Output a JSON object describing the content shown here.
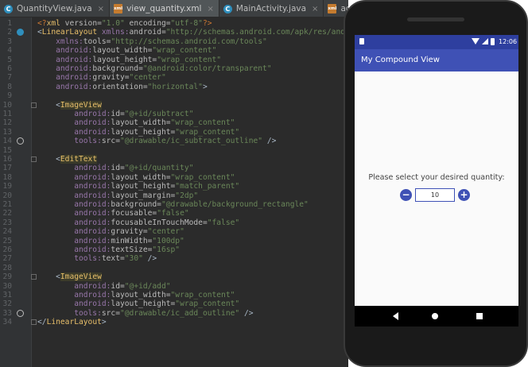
{
  "tabs": [
    {
      "label": "QuantityView.java",
      "icon": "java",
      "icon_char": "C",
      "active": false
    },
    {
      "label": "view_quantity.xml",
      "icon": "xml",
      "icon_char": "xml",
      "active": true
    },
    {
      "label": "MainActivity.java",
      "icon": "java",
      "icon_char": "C",
      "active": false
    },
    {
      "label": "activity_main.xml",
      "icon": "xml",
      "icon_char": "xml",
      "active": false
    }
  ],
  "editor": {
    "lines": [
      {
        "n": "1",
        "parts": [
          [
            "pi",
            "<?"
          ],
          [
            "tag",
            "xml "
          ],
          [
            "attr",
            "version="
          ],
          [
            "val",
            "\"1.0\" "
          ],
          [
            "attr",
            "encoding="
          ],
          [
            "val",
            "\"utf-8\""
          ],
          [
            "pi",
            "?>"
          ]
        ]
      },
      {
        "n": "2",
        "icon": "class-marker-icon",
        "parts": [
          [
            "pun",
            "<"
          ],
          [
            "tag",
            "LinearLayout "
          ],
          [
            "ns",
            "xmlns:"
          ],
          [
            "attr",
            "android="
          ],
          [
            "val",
            "\"http://schemas.android.com/apk/res/android\""
          ]
        ]
      },
      {
        "n": "3",
        "parts": [
          [
            "ns",
            "    xmlns:"
          ],
          [
            "attr",
            "tools="
          ],
          [
            "val",
            "\"http://schemas.android.com/tools\""
          ]
        ]
      },
      {
        "n": "4",
        "parts": [
          [
            "ns",
            "    android:"
          ],
          [
            "attr",
            "layout_width="
          ],
          [
            "val",
            "\"wrap_content\""
          ]
        ]
      },
      {
        "n": "5",
        "parts": [
          [
            "ns",
            "    android:"
          ],
          [
            "attr",
            "layout_height="
          ],
          [
            "val",
            "\"wrap_content\""
          ]
        ]
      },
      {
        "n": "6",
        "parts": [
          [
            "ns",
            "    android:"
          ],
          [
            "attr",
            "background="
          ],
          [
            "val",
            "\"@android:color/transparent\""
          ]
        ]
      },
      {
        "n": "7",
        "parts": [
          [
            "ns",
            "    android:"
          ],
          [
            "attr",
            "gravity="
          ],
          [
            "val",
            "\"center\""
          ]
        ]
      },
      {
        "n": "8",
        "parts": [
          [
            "ns",
            "    android:"
          ],
          [
            "attr",
            "orientation="
          ],
          [
            "val",
            "\"horizontal\""
          ],
          [
            "pun",
            ">"
          ]
        ]
      },
      {
        "n": "9",
        "parts": []
      },
      {
        "n": "10",
        "parts": [
          [
            "pun",
            "    <"
          ],
          [
            "hl",
            "ImageView"
          ]
        ]
      },
      {
        "n": "11",
        "parts": [
          [
            "ns",
            "        android:"
          ],
          [
            "attr",
            "id="
          ],
          [
            "val",
            "\"@+id/subtract\""
          ]
        ]
      },
      {
        "n": "12",
        "parts": [
          [
            "ns",
            "        android:"
          ],
          [
            "attr",
            "layout_width="
          ],
          [
            "val",
            "\"wrap_content\""
          ]
        ]
      },
      {
        "n": "13",
        "parts": [
          [
            "ns",
            "        android:"
          ],
          [
            "attr",
            "layout_height="
          ],
          [
            "val",
            "\"wrap_content\""
          ]
        ]
      },
      {
        "n": "14",
        "icon": "subtract-marker-icon",
        "parts": [
          [
            "ns",
            "        tools:"
          ],
          [
            "attr",
            "src="
          ],
          [
            "val",
            "\"@drawable/ic_subtract_outline\" "
          ],
          [
            "pun",
            "/>"
          ]
        ]
      },
      {
        "n": "15",
        "parts": []
      },
      {
        "n": "16",
        "parts": [
          [
            "pun",
            "    <"
          ],
          [
            "hl",
            "EditText"
          ]
        ]
      },
      {
        "n": "17",
        "parts": [
          [
            "ns",
            "        android:"
          ],
          [
            "attr",
            "id="
          ],
          [
            "val",
            "\"@+id/quantity\""
          ]
        ]
      },
      {
        "n": "18",
        "parts": [
          [
            "ns",
            "        android:"
          ],
          [
            "attr",
            "layout_width="
          ],
          [
            "val",
            "\"wrap_content\""
          ]
        ]
      },
      {
        "n": "19",
        "parts": [
          [
            "ns",
            "        android:"
          ],
          [
            "attr",
            "layout_height="
          ],
          [
            "val",
            "\"match_parent\""
          ]
        ]
      },
      {
        "n": "20",
        "parts": [
          [
            "ns",
            "        android:"
          ],
          [
            "attr",
            "layout_margin="
          ],
          [
            "val",
            "\"2dp\""
          ]
        ]
      },
      {
        "n": "21",
        "parts": [
          [
            "ns",
            "        android:"
          ],
          [
            "attr",
            "background="
          ],
          [
            "val",
            "\"@drawable/background_rectangle\""
          ]
        ]
      },
      {
        "n": "22",
        "parts": [
          [
            "ns",
            "        android:"
          ],
          [
            "attr",
            "focusable="
          ],
          [
            "val",
            "\"false\""
          ]
        ]
      },
      {
        "n": "23",
        "parts": [
          [
            "ns",
            "        android:"
          ],
          [
            "attr",
            "focusableInTouchMode="
          ],
          [
            "val",
            "\"false\""
          ]
        ]
      },
      {
        "n": "24",
        "parts": [
          [
            "ns",
            "        android:"
          ],
          [
            "attr",
            "gravity="
          ],
          [
            "val",
            "\"center\""
          ]
        ]
      },
      {
        "n": "25",
        "parts": [
          [
            "ns",
            "        android:"
          ],
          [
            "attr",
            "minWidth="
          ],
          [
            "val",
            "\"100dp\""
          ]
        ]
      },
      {
        "n": "26",
        "parts": [
          [
            "ns",
            "        android:"
          ],
          [
            "attr",
            "textSize="
          ],
          [
            "val",
            "\"16sp\""
          ]
        ]
      },
      {
        "n": "27",
        "parts": [
          [
            "ns",
            "        tools:"
          ],
          [
            "attr",
            "text="
          ],
          [
            "val",
            "\"30\" "
          ],
          [
            "pun",
            "/>"
          ]
        ]
      },
      {
        "n": "28",
        "parts": []
      },
      {
        "n": "29",
        "parts": [
          [
            "pun",
            "    <"
          ],
          [
            "hl",
            "ImageView"
          ]
        ]
      },
      {
        "n": "30",
        "parts": [
          [
            "ns",
            "        android:"
          ],
          [
            "attr",
            "id="
          ],
          [
            "val",
            "\"@+id/add\""
          ]
        ]
      },
      {
        "n": "31",
        "parts": [
          [
            "ns",
            "        android:"
          ],
          [
            "attr",
            "layout_width="
          ],
          [
            "val",
            "\"wrap_content\""
          ]
        ]
      },
      {
        "n": "32",
        "parts": [
          [
            "ns",
            "        android:"
          ],
          [
            "attr",
            "layout_height="
          ],
          [
            "val",
            "\"wrap_content\""
          ]
        ]
      },
      {
        "n": "33",
        "icon": "add-marker-icon",
        "parts": [
          [
            "ns",
            "        tools:"
          ],
          [
            "attr",
            "src="
          ],
          [
            "val",
            "\"@drawable/ic_add_outline\" "
          ],
          [
            "pun",
            "/>"
          ]
        ]
      },
      {
        "n": "34",
        "parts": [
          [
            "pun",
            "</"
          ],
          [
            "tag",
            "LinearLayout"
          ],
          [
            "pun",
            ">"
          ]
        ]
      }
    ]
  },
  "phone": {
    "clock": "12:06",
    "app_title": "My Compound View",
    "prompt": "Please select your desired quantity:",
    "quantity_value": "10",
    "subtract_glyph": "−",
    "add_glyph": "+",
    "accent_color": "#3f51b5",
    "statusbar_color": "#2e3f9f"
  }
}
